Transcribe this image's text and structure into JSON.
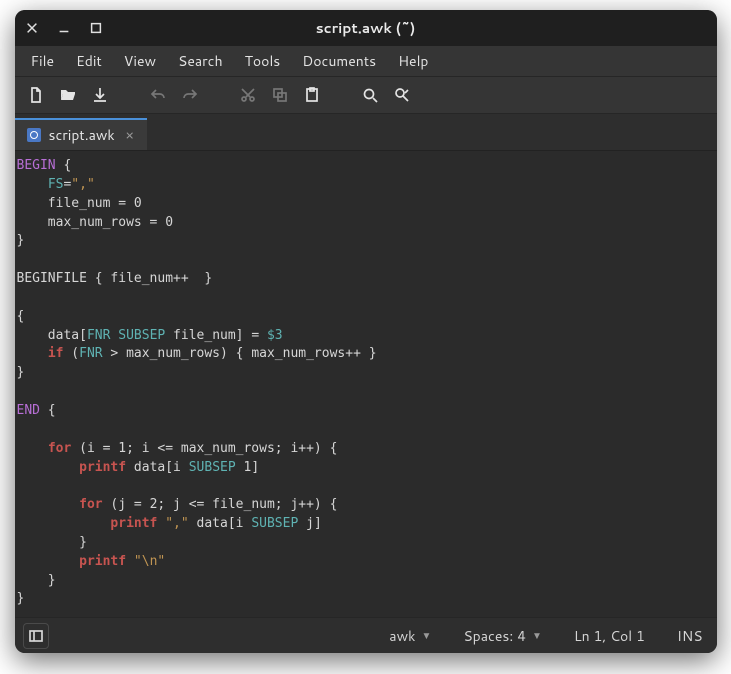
{
  "window": {
    "title": "script.awk (~)"
  },
  "menus": [
    "File",
    "Edit",
    "View",
    "Search",
    "Tools",
    "Documents",
    "Help"
  ],
  "tab": {
    "label": "script.awk"
  },
  "code": {
    "lines": [
      [
        [
          "begin",
          "BEGIN"
        ],
        [
          "",
          " {"
        ]
      ],
      [
        [
          "",
          "    "
        ],
        [
          "fs",
          "FS"
        ],
        [
          "",
          "="
        ],
        [
          "str",
          "\",\""
        ]
      ],
      [
        [
          "",
          "    file_num = 0"
        ]
      ],
      [
        [
          "",
          "    max_num_rows = 0"
        ]
      ],
      [
        [
          "",
          "}"
        ]
      ],
      [
        [
          "",
          ""
        ]
      ],
      [
        [
          "",
          "BEGINFILE { file_num++  }"
        ]
      ],
      [
        [
          "",
          ""
        ]
      ],
      [
        [
          "",
          "{"
        ]
      ],
      [
        [
          "",
          "    data["
        ],
        [
          "subsep",
          "FNR SUBSEP"
        ],
        [
          "",
          " file_num] = "
        ],
        [
          "field",
          "$3"
        ]
      ],
      [
        [
          "",
          "    "
        ],
        [
          "if",
          "if"
        ],
        [
          "",
          " ("
        ],
        [
          "subsep",
          "FNR"
        ],
        [
          "",
          " > max_num_rows) { max_num_rows++ }"
        ]
      ],
      [
        [
          "",
          "}"
        ]
      ],
      [
        [
          "",
          ""
        ]
      ],
      [
        [
          "begin",
          "END"
        ],
        [
          "",
          " {"
        ]
      ],
      [
        [
          "",
          ""
        ]
      ],
      [
        [
          "",
          "    "
        ],
        [
          "for",
          "for"
        ],
        [
          "",
          " (i = 1; i <= max_num_rows; i++) {"
        ]
      ],
      [
        [
          "",
          "        "
        ],
        [
          "printf",
          "printf"
        ],
        [
          "",
          " data[i "
        ],
        [
          "subsep",
          "SUBSEP"
        ],
        [
          "",
          " 1]"
        ]
      ],
      [
        [
          "",
          ""
        ]
      ],
      [
        [
          "",
          "        "
        ],
        [
          "for",
          "for"
        ],
        [
          "",
          " (j = 2; j <= file_num; j++) {"
        ]
      ],
      [
        [
          "",
          "            "
        ],
        [
          "printf",
          "printf"
        ],
        [
          "",
          " "
        ],
        [
          "str",
          "\",\""
        ],
        [
          "",
          " data[i "
        ],
        [
          "subsep",
          "SUBSEP"
        ],
        [
          "",
          " j]"
        ]
      ],
      [
        [
          "",
          "        }"
        ]
      ],
      [
        [
          "",
          "        "
        ],
        [
          "printf",
          "printf"
        ],
        [
          "",
          " "
        ],
        [
          "str",
          "\"\\n\""
        ]
      ],
      [
        [
          "",
          "    }"
        ]
      ],
      [
        [
          "",
          "}"
        ]
      ]
    ]
  },
  "status": {
    "language": "awk",
    "spaces": "Spaces: 4",
    "position": "Ln 1, Col 1",
    "mode": "INS"
  }
}
